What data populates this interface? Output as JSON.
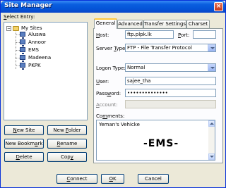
{
  "window": {
    "title": "Site Manager",
    "close_glyph": "×"
  },
  "select_entry": {
    "prefix": "S",
    "rest": "elect Entry:"
  },
  "tree": {
    "root": "My Sites",
    "sites": [
      "Aluswa",
      "Annoor",
      "EMS",
      "Madeena",
      "PKPK"
    ]
  },
  "buttons": {
    "new_site": {
      "pre": "",
      "u": "N",
      "post": "ew Site"
    },
    "new_folder": {
      "pre": "New ",
      "u": "F",
      "post": "older"
    },
    "new_bookmark": {
      "pre": "New Bookm",
      "u": "a",
      "post": "rk"
    },
    "rename": {
      "pre": "",
      "u": "R",
      "post": "ename"
    },
    "delete": {
      "pre": "",
      "u": "D",
      "post": "elete"
    },
    "copy": {
      "pre": "Cop",
      "u": "y",
      "post": ""
    },
    "connect": {
      "pre": "",
      "u": "C",
      "post": "onnect"
    },
    "ok": {
      "pre": "",
      "u": "O",
      "post": "K"
    },
    "cancel": {
      "pre": "Cancel",
      "u": "",
      "post": ""
    }
  },
  "tabs": [
    "General",
    "Advanced",
    "Transfer Settings",
    "Charset"
  ],
  "general": {
    "host_label": {
      "u": "H",
      "post": "ost:"
    },
    "host_value": "ftp.plpk.lk",
    "port_label": {
      "u": "P",
      "post": "ort:"
    },
    "port_value": "",
    "server_type_label": {
      "pre": "Server ",
      "u": "T",
      "post": "ype:"
    },
    "server_type_value": "FTP - File Transfer Protocol",
    "logon_type_label": {
      "pre": "Logon Type",
      "u": "",
      "post": ":"
    },
    "logon_type_value": "Normal",
    "user_label": {
      "u": "U",
      "post": "ser:"
    },
    "user_value": "sajee_tha",
    "password_label": {
      "pre": "Pass",
      "u": "w",
      "post": "ord:"
    },
    "password_value": "••••••••••••••",
    "account_label": {
      "u": "A",
      "post": "ccount:"
    },
    "account_value": "",
    "comments_label": {
      "pre": "Co",
      "u": "m",
      "post": "ments:"
    },
    "comments_line1": "Yeman's Vehicke",
    "comments_big": "-EMS-"
  }
}
